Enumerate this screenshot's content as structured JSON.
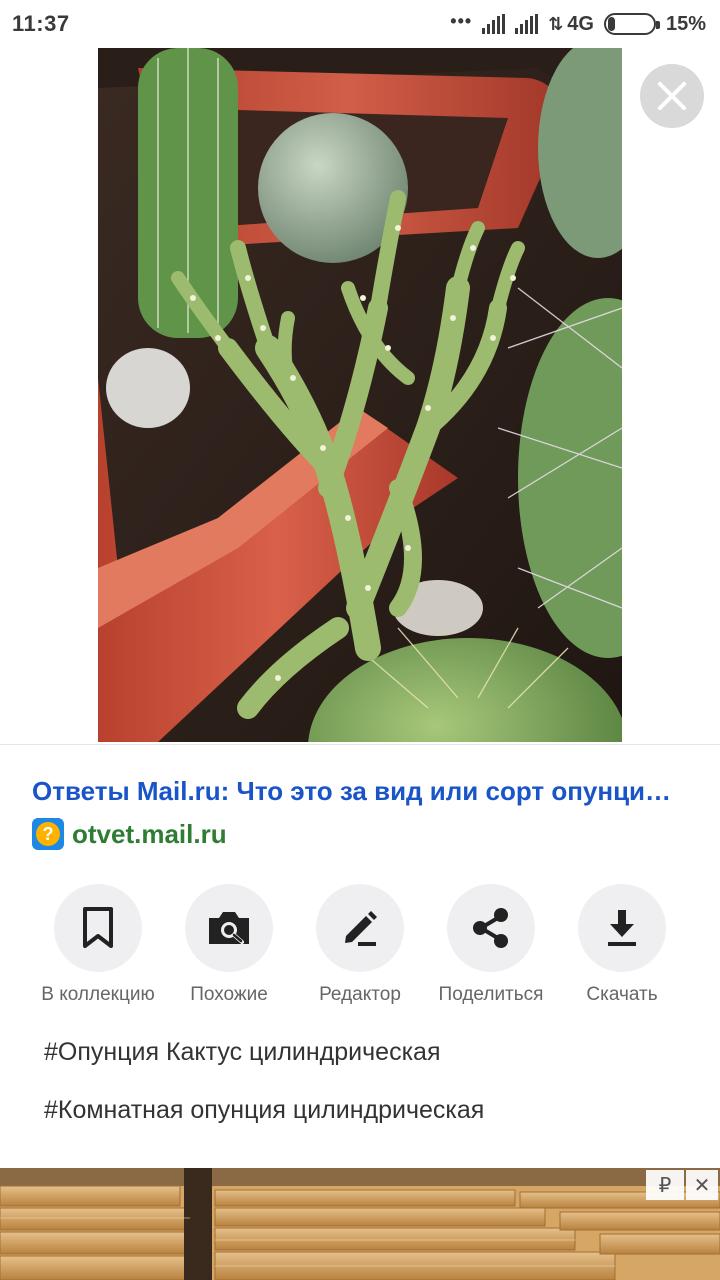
{
  "status_bar": {
    "time": "11:37",
    "dots": "•••",
    "network": "4G",
    "battery_level": 0.15,
    "battery_percent": "15%"
  },
  "result": {
    "title": "Ответы Mail.ru: Что это за вид или сорт опунци…",
    "source": "otvet.mail.ru",
    "source_icon": "?"
  },
  "actions": [
    {
      "label": "В коллекцию",
      "icon": "bookmark-icon"
    },
    {
      "label": "Похожие",
      "icon": "camera-search-icon"
    },
    {
      "label": "Редактор",
      "icon": "pencil-icon"
    },
    {
      "label": "Поделиться",
      "icon": "share-icon"
    },
    {
      "label": "Скачать",
      "icon": "download-icon"
    }
  ],
  "tags": [
    "#Опунция Кактус цилиндрическая",
    "#Комнатная опунция цилиндрическая"
  ],
  "ad": {
    "currency_badge": "₽",
    "close_badge": "✕"
  },
  "colors": {
    "title_link": "#1a55c7",
    "source_link": "#2e7d32",
    "action_bg": "#efeff1"
  }
}
